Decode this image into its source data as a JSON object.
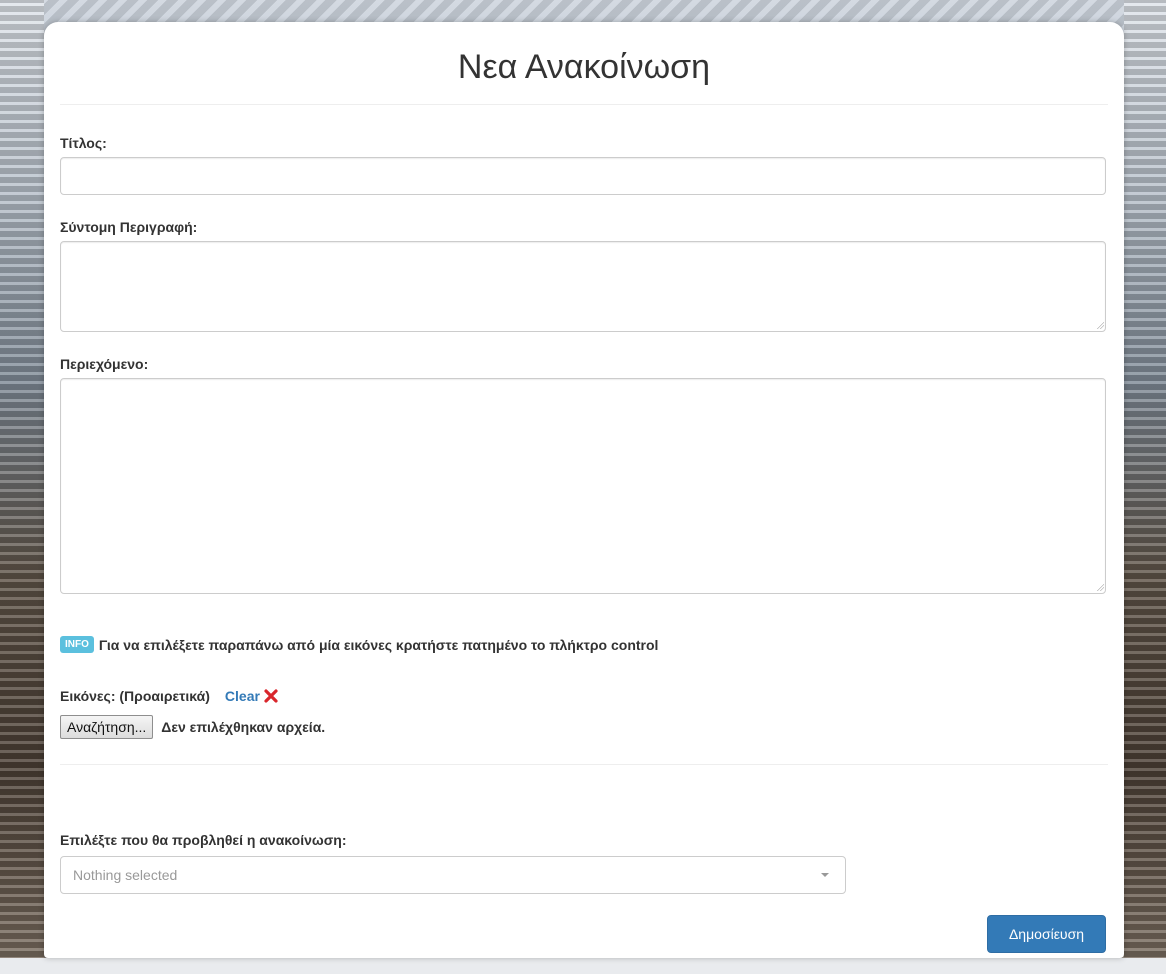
{
  "page": {
    "heading": "Νεα Ανακοίνωση"
  },
  "form": {
    "title_label": "Τίτλος:",
    "title_value": "",
    "short_desc_label": "Σύντομη Περιγραφή:",
    "short_desc_value": "",
    "content_label": "Περιεχόμενο:",
    "content_value": "",
    "info_badge": "INFO",
    "info_text": "Για να επιλέξετε παραπάνω από μία εικόνες κρατήστε πατημένο το πλήκτρο control",
    "images_label": "Εικόνες: (Προαιρετικά)",
    "clear_label": "Clear",
    "clear_icon": "red-x-icon",
    "browse_button": "Αναζήτηση...",
    "no_files_text": "Δεν επιλέχθηκαν αρχεία.",
    "display_label": "Επιλέξτε που θα προβληθεί η ανακοίνωση:",
    "display_select_value": "Nothing selected",
    "publish_button": "Δημοσίευση"
  },
  "colors": {
    "primary": "#337ab7",
    "info": "#5bc0de",
    "danger": "#d9262c"
  }
}
